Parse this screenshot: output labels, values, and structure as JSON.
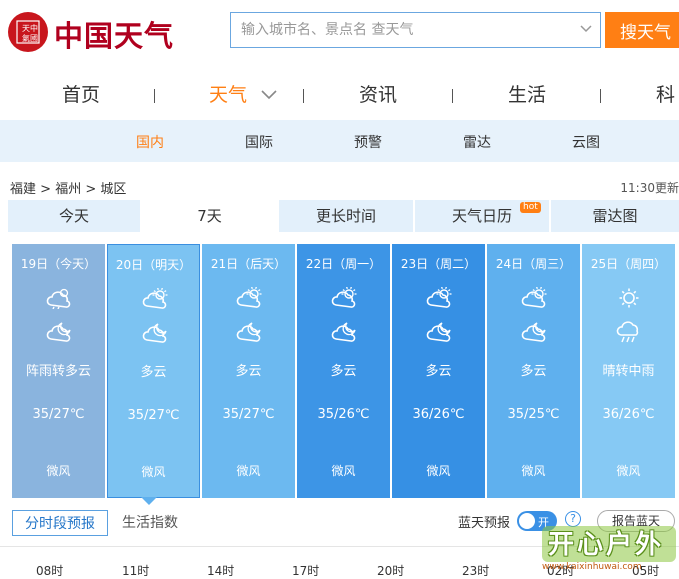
{
  "header": {
    "logo_seal": "中國天氣",
    "logo_text": "中国天气",
    "search_placeholder": "输入城市名、景点名 查天气",
    "search_button": "搜天气"
  },
  "main_nav": [
    {
      "label": "首页"
    },
    {
      "label": "天气"
    },
    {
      "label": "资讯"
    },
    {
      "label": "生活"
    },
    {
      "label": "科"
    }
  ],
  "sub_nav": [
    {
      "label": "国内"
    },
    {
      "label": "国际"
    },
    {
      "label": "预警"
    },
    {
      "label": "雷达"
    },
    {
      "label": "云图"
    }
  ],
  "breadcrumb": {
    "province": "福建",
    "city": "福州",
    "district": "城区",
    "separator": ">"
  },
  "update_time": "11:30更新",
  "tabs": [
    {
      "label": "今天"
    },
    {
      "label": "7天"
    },
    {
      "label": "更长时间"
    },
    {
      "label": "天气日历"
    },
    {
      "label": "雷达图"
    }
  ],
  "hot_badge": "hot",
  "forecast": [
    {
      "date": "19日（今天）",
      "icon_day": "shower-cloud-icon",
      "icon_night": "cloudy-night-icon",
      "condition": "阵雨转多云",
      "temp": "35/27℃",
      "wind": "微风",
      "bg": "#8ab4de"
    },
    {
      "date": "20日（明天）",
      "icon_day": "partly-cloudy-icon",
      "icon_night": "cloudy-night-icon",
      "condition": "多云",
      "temp": "35/27℃",
      "wind": "微风",
      "bg": "#7cc3f2"
    },
    {
      "date": "21日（后天）",
      "icon_day": "partly-cloudy-icon",
      "icon_night": "cloudy-night-icon",
      "condition": "多云",
      "temp": "35/27℃",
      "wind": "微风",
      "bg": "#6cb9f0"
    },
    {
      "date": "22日（周一）",
      "icon_day": "partly-cloudy-icon",
      "icon_night": "cloudy-night-icon",
      "condition": "多云",
      "temp": "35/26℃",
      "wind": "微风",
      "bg": "#3d95e6"
    },
    {
      "date": "23日（周二）",
      "icon_day": "partly-cloudy-icon",
      "icon_night": "cloudy-night-icon",
      "condition": "多云",
      "temp": "36/26℃",
      "wind": "微风",
      "bg": "#3690e4"
    },
    {
      "date": "24日（周三）",
      "icon_day": "partly-cloudy-icon",
      "icon_night": "cloudy-night-icon",
      "condition": "多云",
      "temp": "35/25℃",
      "wind": "微风",
      "bg": "#5fb0ee"
    },
    {
      "date": "25日（周四）",
      "icon_day": "sun-icon",
      "icon_night": "rain-cloud-icon",
      "condition": "晴转中雨",
      "temp": "36/26℃",
      "wind": "微风",
      "bg": "#86c9f4"
    }
  ],
  "bottom": {
    "tab_active": "分时段预报",
    "tab_other": "生活指数",
    "bluesky_label": "蓝天预报",
    "toggle_text": "开",
    "help": "?",
    "report_button": "报告蓝天"
  },
  "hours": [
    "08时",
    "11时",
    "14时",
    "17时",
    "20时",
    "23时",
    "02时",
    "05时"
  ],
  "watermark": {
    "text": "开心户外",
    "url": "www.kaixinhuwai.com"
  },
  "colors": {
    "accent_orange": "#ff7f14",
    "brand_red": "#c8161d",
    "link_blue": "#2677c9"
  }
}
